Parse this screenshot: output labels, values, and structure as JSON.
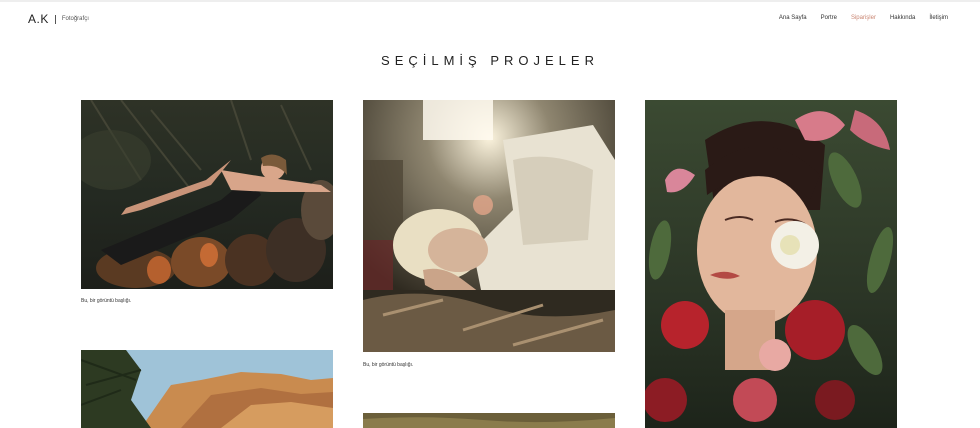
{
  "header": {
    "brand_name": "A.K",
    "brand_subtitle": "Fotoğrafçı",
    "nav": [
      {
        "label": "Ana Sayfa"
      },
      {
        "label": "Portre"
      },
      {
        "label": "Siparişler"
      },
      {
        "label": "Hakkında"
      },
      {
        "label": "İletişim"
      }
    ],
    "active_nav": "Siparişler",
    "accent_color": "#c98471"
  },
  "main": {
    "title": "SEÇİLMİŞ PROJELER",
    "captions": [
      "Bu, bir görüntü başlığı.",
      "Bu, bir görüntü başlığı."
    ]
  }
}
